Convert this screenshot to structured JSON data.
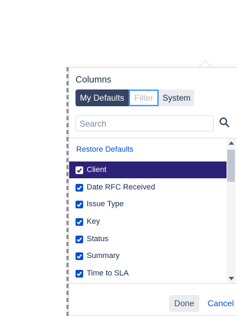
{
  "popup": {
    "title": "Columns",
    "tabs": [
      {
        "label": "My Defaults",
        "state": "active"
      },
      {
        "label": "Filter",
        "state": "disabled"
      },
      {
        "label": "System",
        "state": "normal"
      }
    ],
    "search": {
      "placeholder": "Search",
      "value": "",
      "icon": "search-icon"
    },
    "restore_label": "Restore Defaults",
    "items": [
      {
        "label": "Client",
        "checked": true,
        "selected": true
      },
      {
        "label": "Date RFC Received",
        "checked": true,
        "selected": false
      },
      {
        "label": "Issue Type",
        "checked": true,
        "selected": false
      },
      {
        "label": "Key",
        "checked": true,
        "selected": false
      },
      {
        "label": "Status",
        "checked": true,
        "selected": false
      },
      {
        "label": "Summary",
        "checked": true,
        "selected": false
      },
      {
        "label": "Time to SLA",
        "checked": true,
        "selected": false
      }
    ],
    "done_label": "Done",
    "cancel_label": "Cancel"
  },
  "colors": {
    "active_tab": "#344563",
    "selected_row": "#2c2277",
    "checkbox": "#0052cc",
    "link": "#0052cc"
  }
}
